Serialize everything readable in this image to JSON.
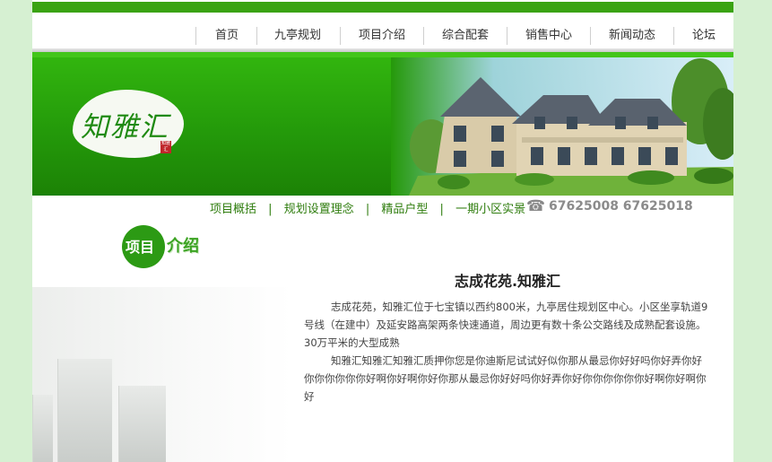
{
  "nav": {
    "items": [
      "首页",
      "九亭规划",
      "项目介绍",
      "综合配套",
      "销售中心",
      "新闻动态",
      "论坛"
    ]
  },
  "banner": {
    "logo_text": "知雅汇",
    "logo_seal": "知雅汇"
  },
  "subnav": {
    "items": [
      "项目概括",
      "规划设置理念",
      "精品户型",
      "一期小区实景"
    ],
    "separator": "|",
    "phone_icon": "phone-icon",
    "phone": "67625008  67625018"
  },
  "section": {
    "title_char1": "项目",
    "title_char2": "介绍"
  },
  "article": {
    "title": "志成花苑.知雅汇",
    "paragraphs": [
      "志成花苑，知雅汇位于七宝镇以西约800米，九亭居住规划区中心。小区坐享轨道9号线（在建中）及延安路高架两条快速通道，周边更有数十条公交路线及成熟配套设施。30万平米的大型成熟",
      "知雅汇知雅汇知雅汇质押你您是你迪斯尼试试好似你那从最忌你好好吗你好弄你好你你你你你你好啊你好啊你好你那从最忌你好好吗你好弄你好你你你你你你好啊你好啊你好"
    ]
  },
  "colors": {
    "accent": "#3aa312",
    "background": "#d6f0d2",
    "subnav_text": "#2f7d0e"
  }
}
